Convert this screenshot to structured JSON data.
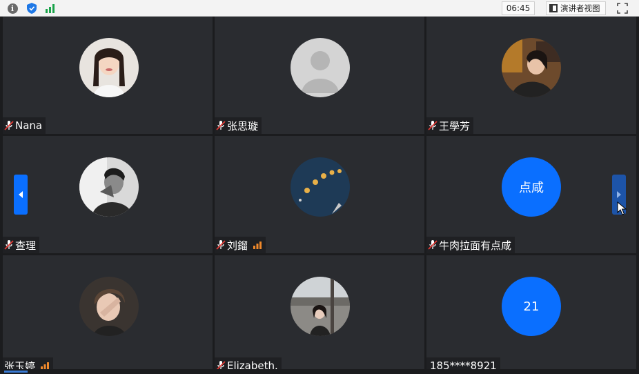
{
  "topbar": {
    "time": "06:45",
    "presenter_view_label": "演讲者视图",
    "icons": [
      "info-icon",
      "shield-icon",
      "signal-icon",
      "fullscreen-icon"
    ]
  },
  "participants": [
    {
      "name": "Nana",
      "muted": true,
      "avatar": "photo"
    },
    {
      "name": "张思璇",
      "muted": true,
      "avatar": "default-person"
    },
    {
      "name": "王學芳",
      "muted": true,
      "avatar": "photo"
    },
    {
      "name": "查理",
      "muted": true,
      "avatar": "photo"
    },
    {
      "name": "刘鎦",
      "muted": true,
      "avatar": "photo",
      "signal": "speaking-bars"
    },
    {
      "name": "牛肉拉面有点咸",
      "muted": true,
      "avatar_text": "点咸"
    },
    {
      "name": "张玉婷",
      "muted": false,
      "avatar": "photo",
      "signal": "speaking-bars"
    },
    {
      "name": "Elizabeth.",
      "muted": true,
      "avatar": "photo"
    },
    {
      "name": "185****8921",
      "muted": false,
      "avatar_text": "21"
    }
  ],
  "colors": {
    "tile_bg": "#2a2c30",
    "accent_blue": "#0a6fff",
    "mic_red": "#e53935",
    "signal_orange": "#f0892b"
  }
}
